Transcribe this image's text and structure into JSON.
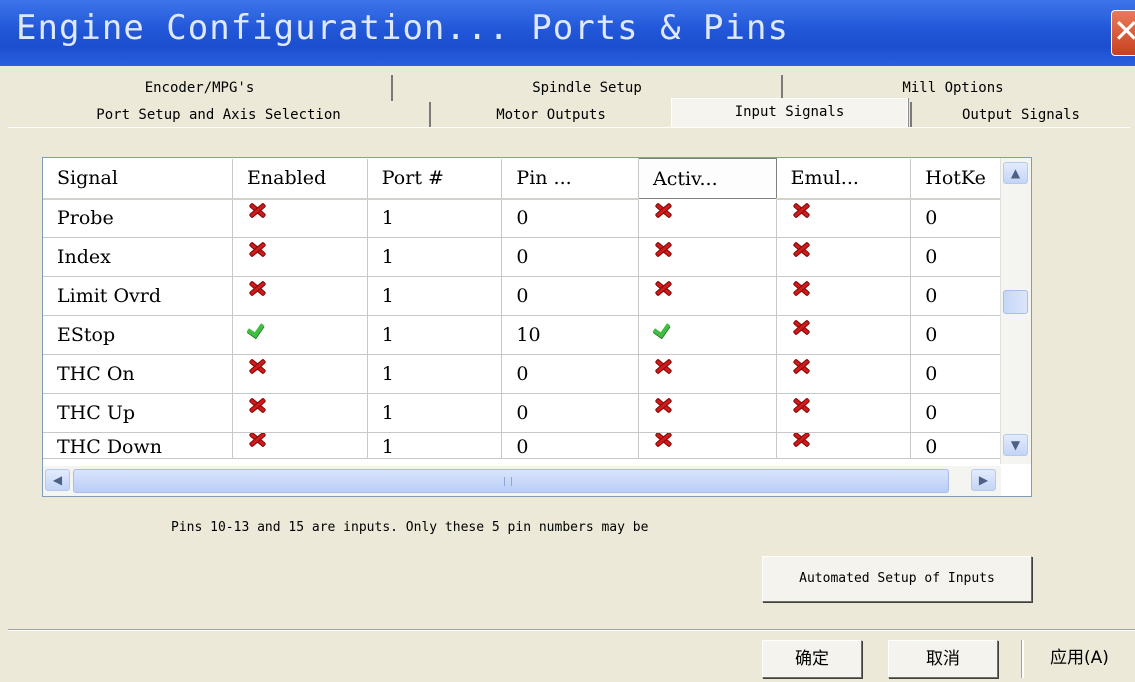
{
  "window": {
    "title": "Engine Configuration... Ports & Pins",
    "close_icon": "close-icon"
  },
  "tabs_row1": [
    {
      "label": "Encoder/MPG's"
    },
    {
      "label": "Spindle Setup"
    },
    {
      "label": "Mill Options"
    }
  ],
  "tabs_row2": [
    {
      "label": "Port Setup and Axis Selection"
    },
    {
      "label": "Motor Outputs"
    },
    {
      "label": "Input Signals",
      "active": true
    },
    {
      "label": "Output Signals"
    }
  ],
  "grid": {
    "columns": [
      "Signal",
      "Enabled",
      "Port #",
      "Pin ...",
      "Activ...",
      "Emul...",
      "HotKe"
    ],
    "rows": [
      {
        "signal": "Probe",
        "enabled": false,
        "port": "1",
        "pin": "0",
        "active_low": false,
        "emulated": false,
        "hotkey": "0"
      },
      {
        "signal": "Index",
        "enabled": false,
        "port": "1",
        "pin": "0",
        "active_low": false,
        "emulated": false,
        "hotkey": "0"
      },
      {
        "signal": "Limit Ovrd",
        "enabled": false,
        "port": "1",
        "pin": "0",
        "active_low": false,
        "emulated": false,
        "hotkey": "0"
      },
      {
        "signal": "EStop",
        "enabled": true,
        "port": "1",
        "pin": "10",
        "active_low": true,
        "emulated": false,
        "hotkey": "0"
      },
      {
        "signal": "THC On",
        "enabled": false,
        "port": "1",
        "pin": "0",
        "active_low": false,
        "emulated": false,
        "hotkey": "0"
      },
      {
        "signal": "THC Up",
        "enabled": false,
        "port": "1",
        "pin": "0",
        "active_low": false,
        "emulated": false,
        "hotkey": "0"
      },
      {
        "signal": "THC Down",
        "enabled": false,
        "port": "1",
        "pin": "0",
        "active_low": false,
        "emulated": false,
        "hotkey": "0"
      }
    ]
  },
  "note": "Pins 10-13 and 15 are inputs. Only these 5 pin numbers may be",
  "buttons": {
    "automated_setup": "Automated Setup of Inputs",
    "ok": "确定",
    "cancel": "取消",
    "apply": "应用(A)"
  },
  "colors": {
    "titlebar": "#2157d8",
    "dialog_bg": "#ece9d8",
    "cross": "#d21a1a",
    "check": "#3fbf3f"
  }
}
